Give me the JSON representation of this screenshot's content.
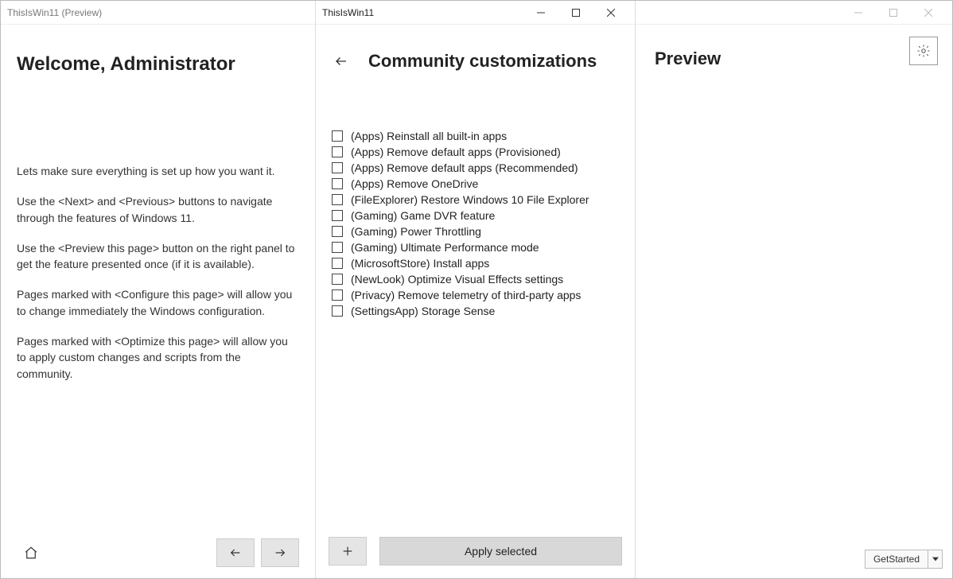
{
  "left": {
    "title": "ThisIsWin11 (Preview)",
    "welcome": "Welcome, Administrator",
    "paras": [
      "Lets make sure everything is set up how you want it.",
      "Use the <Next> and <Previous> buttons to navigate through the features of Windows 11.",
      "Use the <Preview this page> button on the right panel to get the feature presented once (if it is available).",
      "Pages marked with <Configure this page> will allow you to change immediately the Windows configuration.",
      "Pages marked with <Optimize this page> will allow you to apply custom changes and scripts from the community."
    ]
  },
  "mid": {
    "title": "ThisIsWin11",
    "heading": "Community customizations",
    "items": [
      "(Apps) Reinstall all built-in apps",
      "(Apps) Remove default apps (Provisioned)",
      "(Apps) Remove default apps (Recommended)",
      "(Apps) Remove OneDrive",
      "(FileExplorer) Restore Windows 10 File Explorer",
      "(Gaming) Game DVR feature",
      "(Gaming) Power Throttling",
      "(Gaming) Ultimate Performance mode",
      "(MicrosoftStore) Install apps",
      "(NewLook) Optimize Visual Effects settings",
      "(Privacy) Remove telemetry of third-party apps",
      "(SettingsApp) Storage Sense"
    ],
    "apply": "Apply selected"
  },
  "right": {
    "heading": "Preview",
    "dropdown": "GetStarted"
  }
}
